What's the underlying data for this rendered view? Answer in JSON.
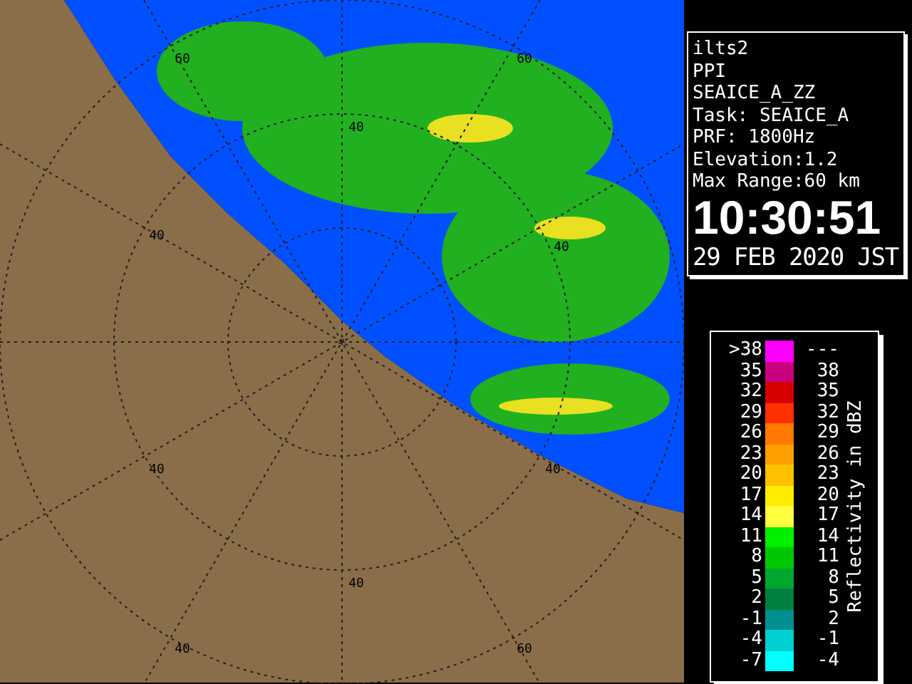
{
  "map": {
    "ring_labels": [
      "60",
      "60",
      "40",
      "40",
      "40",
      "40",
      "40",
      "40",
      "40",
      "60"
    ]
  },
  "info": {
    "lines": [
      "ilts2",
      "PPI",
      "SEAICE_A_ZZ",
      "Task: SEAICE_A",
      "PRF: 1800Hz",
      "Elevation:1.2",
      "Max Range:60 km"
    ],
    "time": "10:30:51",
    "date": "29 FEB 2020 JST"
  },
  "legend": {
    "title": "Reflectivity in dBZ",
    "rows": [
      {
        "low": ">38",
        "high": "---",
        "color": "#ff00ff"
      },
      {
        "low": "35",
        "high": "38",
        "color": "#c8007f"
      },
      {
        "low": "32",
        "high": "35",
        "color": "#d80000"
      },
      {
        "low": "29",
        "high": "32",
        "color": "#ff3000"
      },
      {
        "low": "26",
        "high": "29",
        "color": "#ff7800"
      },
      {
        "low": "23",
        "high": "26",
        "color": "#ffa000"
      },
      {
        "low": "20",
        "high": "23",
        "color": "#ffc000"
      },
      {
        "low": "17",
        "high": "20",
        "color": "#ffec00"
      },
      {
        "low": "14",
        "high": "17",
        "color": "#ffff40"
      },
      {
        "low": "11",
        "high": "14",
        "color": "#00f000"
      },
      {
        "low": "8",
        "high": "11",
        "color": "#00c800"
      },
      {
        "low": "5",
        "high": "8",
        "color": "#00a830"
      },
      {
        "low": "2",
        "high": "5",
        "color": "#008040"
      },
      {
        "low": "-1",
        "high": "2",
        "color": "#009090"
      },
      {
        "low": "-4",
        "high": "-1",
        "color": "#00d0d0"
      },
      {
        "low": "-7",
        "high": "-4",
        "color": "#00ffff"
      }
    ]
  }
}
